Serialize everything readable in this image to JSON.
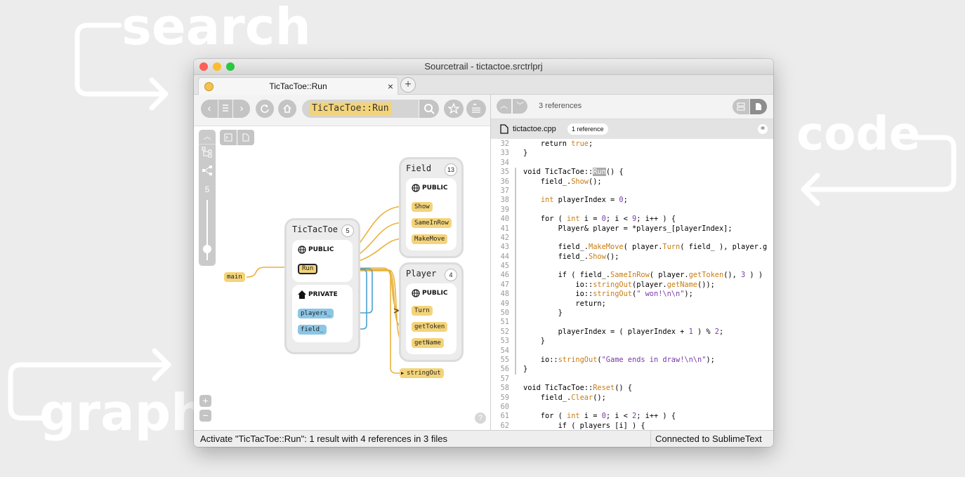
{
  "overlay": {
    "search": "search",
    "code": "code",
    "graph": "graph"
  },
  "window": {
    "title": "Sourcetrail - tictactoe.srctrlprj",
    "tab": {
      "label": "TicTacToe::Run",
      "close": "×",
      "add": "+"
    }
  },
  "graph": {
    "search_text": "TicTacToe::Run",
    "depth_value": "5",
    "main_node": "main",
    "tictactoe": {
      "name": "TicTacToe",
      "count": "5",
      "public_label": "PUBLIC",
      "public_members": [
        "Run"
      ],
      "private_label": "PRIVATE",
      "private_members": [
        "players_",
        "field_"
      ]
    },
    "field": {
      "name": "Field",
      "count": "13",
      "public_label": "PUBLIC",
      "public_members": [
        "Show",
        "SameInRow",
        "MakeMove"
      ]
    },
    "player": {
      "name": "Player",
      "count": "4",
      "public_label": "PUBLIC",
      "public_members": [
        "Turn",
        "getToken",
        "getName"
      ]
    },
    "stringout": "stringOut",
    "zoom_in": "+",
    "zoom_out": "−",
    "help": "?"
  },
  "code_view": {
    "reference_count": "3 references",
    "file": {
      "name": "tictactoe.cpp",
      "badge": "1 reference"
    },
    "lines": [
      {
        "n": "32",
        "t": "    return true;"
      },
      {
        "n": "33",
        "t": "}"
      },
      {
        "n": "34",
        "t": ""
      },
      {
        "n": "35",
        "t": "void TicTacToe::Run() {"
      },
      {
        "n": "36",
        "t": "    field_.Show();"
      },
      {
        "n": "37",
        "t": ""
      },
      {
        "n": "38",
        "t": "    int playerIndex = 0;"
      },
      {
        "n": "39",
        "t": ""
      },
      {
        "n": "40",
        "t": "    for ( int i = 0; i < 9; i++ ) {"
      },
      {
        "n": "41",
        "t": "        Player& player = *players_[playerIndex];"
      },
      {
        "n": "42",
        "t": ""
      },
      {
        "n": "43",
        "t": "        field_.MakeMove( player.Turn( field_ ), player.g"
      },
      {
        "n": "44",
        "t": "        field_.Show();"
      },
      {
        "n": "45",
        "t": ""
      },
      {
        "n": "46",
        "t": "        if ( field_.SameInRow( player.getToken(), 3 ) )"
      },
      {
        "n": "47",
        "t": "            io::stringOut(player.getName());"
      },
      {
        "n": "48",
        "t": "            io::stringOut(\" won!\\n\\n\");"
      },
      {
        "n": "49",
        "t": "            return;"
      },
      {
        "n": "50",
        "t": "        }"
      },
      {
        "n": "51",
        "t": ""
      },
      {
        "n": "52",
        "t": "        playerIndex = ( playerIndex + 1 ) % 2;"
      },
      {
        "n": "53",
        "t": "    }"
      },
      {
        "n": "54",
        "t": ""
      },
      {
        "n": "55",
        "t": "    io::stringOut(\"Game ends in draw!\\n\\n\");"
      },
      {
        "n": "56",
        "t": "}"
      },
      {
        "n": "57",
        "t": ""
      },
      {
        "n": "58",
        "t": "void TicTacToe::Reset() {"
      },
      {
        "n": "59",
        "t": "    field_.Clear();"
      },
      {
        "n": "60",
        "t": ""
      },
      {
        "n": "61",
        "t": "    for ( int i = 0; i < 2; i++ ) {"
      },
      {
        "n": "62",
        "t": "        if ( players [i] ) {"
      }
    ]
  },
  "status": {
    "left": "Activate \"TicTacToe::Run\": 1 result with 4 references in 3 files",
    "right": "Connected to SublimeText"
  },
  "colors": {
    "node_yellow": "#f4d47a",
    "node_blue": "#8cc6e6",
    "edge_yellow": "#eab23a",
    "edge_blue": "#4aa2d2"
  }
}
